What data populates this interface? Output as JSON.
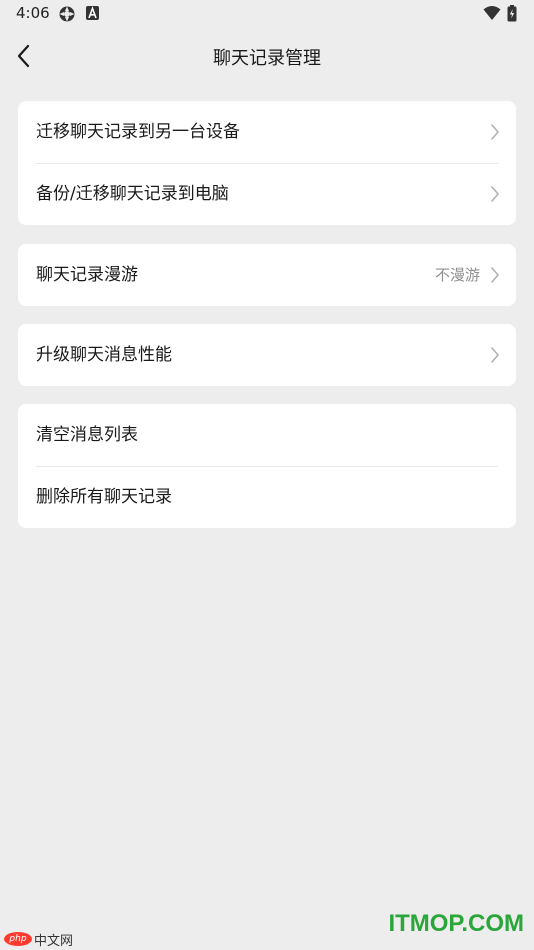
{
  "status_bar": {
    "time": "4:06",
    "left_icons": [
      "sync-icon",
      "a-badge-icon"
    ],
    "right_icons": [
      "wifi-icon",
      "battery-icon"
    ]
  },
  "header": {
    "title": "聊天记录管理",
    "back_icon": "chevron-left-icon"
  },
  "groups": [
    {
      "items": [
        {
          "label": "迁移聊天记录到另一台设备",
          "chevron": true
        },
        {
          "label": "备份/迁移聊天记录到电脑",
          "chevron": true
        }
      ]
    },
    {
      "items": [
        {
          "label": "聊天记录漫游",
          "value": "不漫游",
          "chevron": true
        }
      ]
    },
    {
      "items": [
        {
          "label": "升级聊天消息性能",
          "chevron": true
        }
      ]
    },
    {
      "items": [
        {
          "label": "清空消息列表",
          "chevron": false
        },
        {
          "label": "删除所有聊天记录",
          "chevron": false
        }
      ]
    }
  ],
  "watermarks": {
    "left_badge": "php",
    "left_text": "中文网",
    "right_text": "ITMOP.COM"
  },
  "colors": {
    "background": "#ededed",
    "card": "#ffffff",
    "secondary_text": "#8f8f8f",
    "chevron": "#b2b2b2",
    "watermark_green": "#2aa63a"
  }
}
